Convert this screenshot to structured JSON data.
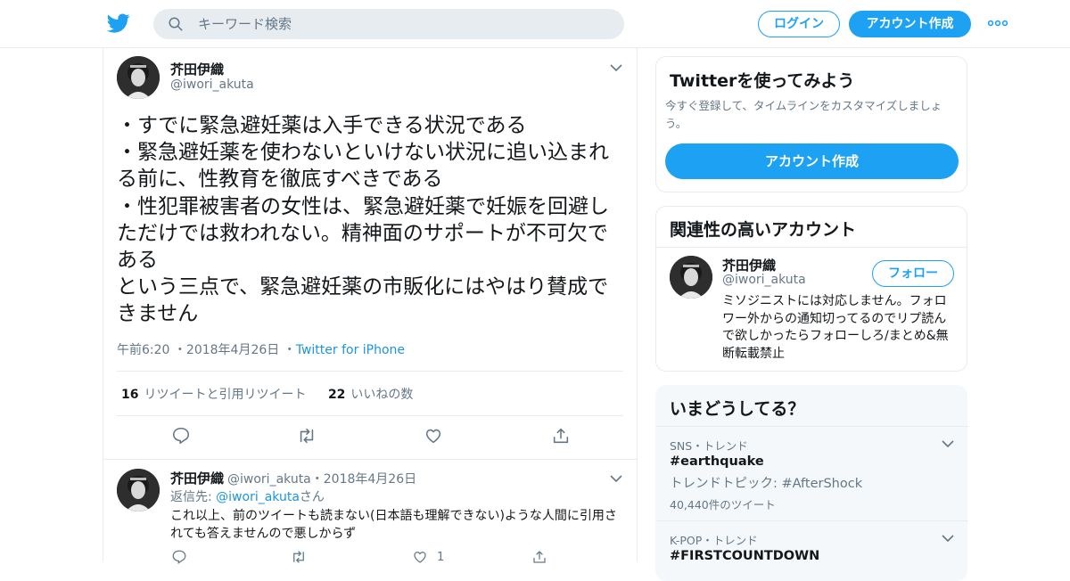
{
  "header": {
    "search_placeholder": "キーワード検索",
    "login_label": "ログイン",
    "signup_label": "アカウント作成"
  },
  "tweet": {
    "name": "芥田伊織",
    "handle": "@iwori_akuta",
    "lines": [
      "・すでに緊急避妊薬は入手できる状況である",
      "・緊急避妊薬を使わないといけない状況に追い込まれ",
      "る前に、性教育を徹底すべきである",
      "・性犯罪被害者の女性は、緊急避妊薬で妊娠を回避し",
      "ただけでは救われない。精神面のサポートが不可欠で",
      "ある",
      "という三点で、緊急避妊薬の市販化にはやはり賛成で",
      "きません"
    ],
    "time": "午前6:20",
    "date": "2018年4月26日",
    "source": "Twitter for iPhone",
    "retweets_count": "16",
    "retweets_label": "リツイートと引用リツイート",
    "likes_count": "22",
    "likes_label": "いいねの数"
  },
  "reply": {
    "name": "芥田伊織",
    "handle": "@iwori_akuta",
    "date": "2018年4月26日",
    "reply_prefix": "返信先: ",
    "reply_to": "@iwori_akuta",
    "reply_suffix": "さん",
    "text": "これ以上、前のツイートも読まない(日本語も理解できない)ような人間に引用されても答えませんので悪しからず",
    "like_count": "1"
  },
  "sidebar": {
    "try_title": "Twitterを使ってみよう",
    "try_desc": "今すぐ登録して、タイムラインをカスタマイズしましょう。",
    "try_button": "アカウント作成",
    "related_title": "関連性の高いアカウント",
    "related_name": "芥田伊織",
    "related_handle": "@iwori_akuta",
    "follow_label": "フォロー",
    "related_bio": "ミソジニストには対応しません。フォロワー外からの通知切ってるのでリプ読んで欲しかったらフォローしろ/まとめ&無断転載禁止",
    "trends_title": "いまどうしてる？",
    "trends": [
      {
        "meta": "SNS・トレンド",
        "tag": "#earthquake",
        "topic": "トレンドトピック: #AfterShock",
        "count": "40,440件のツイート"
      },
      {
        "meta": "K-POP・トレンド",
        "tag": "#FIRSTCOUNTDOWN"
      }
    ]
  },
  "colors": {
    "accent": "#1da1f2",
    "link": "#1b95e0",
    "muted": "#657786",
    "border": "#e6ecf0"
  },
  "icons": [
    "twitter-bird-icon",
    "search-icon",
    "more-icon",
    "chevron-down-icon",
    "reply-icon",
    "retweet-icon",
    "like-icon",
    "share-icon"
  ]
}
